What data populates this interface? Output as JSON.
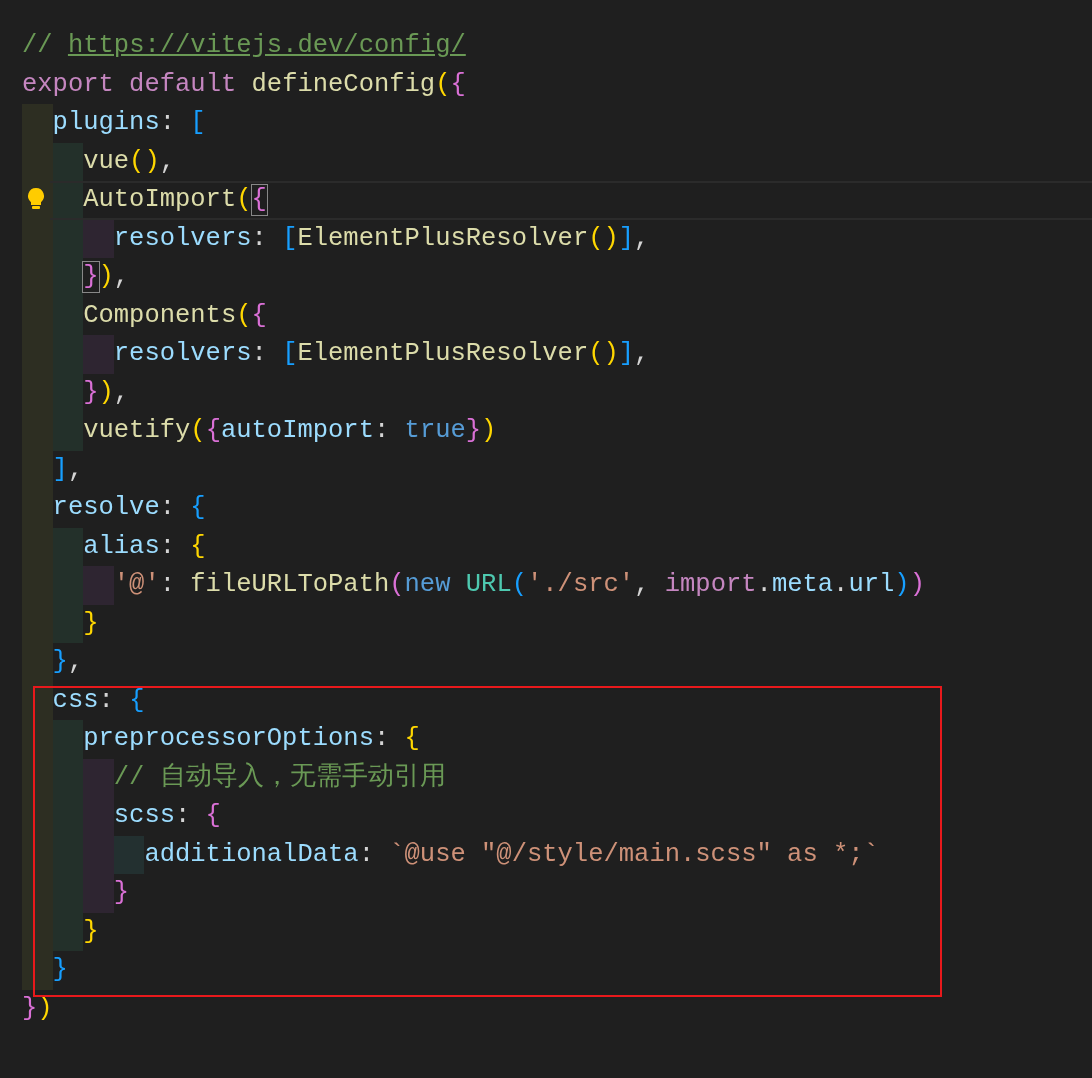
{
  "editor": {
    "lines": [
      {
        "current": false,
        "tokens": [
          {
            "kind": "comment",
            "text": "// "
          },
          {
            "kind": "link",
            "text": "https://vitejs.dev/config/"
          }
        ]
      },
      {
        "current": false,
        "tokens": [
          {
            "kind": "keyword",
            "text": "export default "
          },
          {
            "kind": "function",
            "text": "defineConfig"
          },
          {
            "kind": "b1",
            "text": "("
          },
          {
            "kind": "b2",
            "text": "{"
          }
        ]
      },
      {
        "current": false,
        "tokens": [
          {
            "kind": "property",
            "text": "  plugins"
          },
          {
            "kind": "punct",
            "text": ": "
          },
          {
            "kind": "b3",
            "text": "["
          }
        ]
      },
      {
        "current": false,
        "tokens": [
          {
            "kind": "function",
            "text": "    vue"
          },
          {
            "kind": "b1",
            "text": "()"
          },
          {
            "kind": "punct",
            "text": ","
          }
        ]
      },
      {
        "current": true,
        "lightbulb": true,
        "tokens": [
          {
            "kind": "function",
            "text": "    AutoImport"
          },
          {
            "kind": "b1",
            "text": "("
          },
          {
            "kind": "b2",
            "text": "{",
            "matched": true
          }
        ]
      },
      {
        "current": false,
        "tokens": [
          {
            "kind": "property",
            "text": "      resolvers"
          },
          {
            "kind": "punct",
            "text": ": "
          },
          {
            "kind": "b3",
            "text": "["
          },
          {
            "kind": "function",
            "text": "ElementPlusResolver"
          },
          {
            "kind": "b1",
            "text": "()"
          },
          {
            "kind": "b3",
            "text": "]"
          },
          {
            "kind": "punct",
            "text": ","
          }
        ]
      },
      {
        "current": false,
        "tokens": [
          {
            "kind": "b2",
            "text": "    }",
            "matched": true
          },
          {
            "kind": "b1",
            "text": ")"
          },
          {
            "kind": "punct",
            "text": ","
          }
        ]
      },
      {
        "current": false,
        "tokens": [
          {
            "kind": "function",
            "text": "    Components"
          },
          {
            "kind": "b1",
            "text": "("
          },
          {
            "kind": "b2",
            "text": "{"
          }
        ]
      },
      {
        "current": false,
        "tokens": [
          {
            "kind": "property",
            "text": "      resolvers"
          },
          {
            "kind": "punct",
            "text": ": "
          },
          {
            "kind": "b3",
            "text": "["
          },
          {
            "kind": "function",
            "text": "ElementPlusResolver"
          },
          {
            "kind": "b1",
            "text": "()"
          },
          {
            "kind": "b3",
            "text": "]"
          },
          {
            "kind": "punct",
            "text": ","
          }
        ]
      },
      {
        "current": false,
        "tokens": [
          {
            "kind": "b2",
            "text": "    }"
          },
          {
            "kind": "b1",
            "text": ")"
          },
          {
            "kind": "punct",
            "text": ","
          }
        ]
      },
      {
        "current": false,
        "tokens": [
          {
            "kind": "function",
            "text": "    vuetify"
          },
          {
            "kind": "b1",
            "text": "("
          },
          {
            "kind": "b2",
            "text": "{"
          },
          {
            "kind": "property",
            "text": "autoImport"
          },
          {
            "kind": "punct",
            "text": ": "
          },
          {
            "kind": "constant",
            "text": "true"
          },
          {
            "kind": "b2",
            "text": "}"
          },
          {
            "kind": "b1",
            "text": ")"
          }
        ]
      },
      {
        "current": false,
        "tokens": [
          {
            "kind": "b3",
            "text": "  ]"
          },
          {
            "kind": "punct",
            "text": ","
          }
        ]
      },
      {
        "current": false,
        "tokens": [
          {
            "kind": "property",
            "text": "  resolve"
          },
          {
            "kind": "punct",
            "text": ": "
          },
          {
            "kind": "b3",
            "text": "{"
          }
        ]
      },
      {
        "current": false,
        "tokens": [
          {
            "kind": "property",
            "text": "    alias"
          },
          {
            "kind": "punct",
            "text": ": "
          },
          {
            "kind": "b1",
            "text": "{"
          }
        ]
      },
      {
        "current": false,
        "tokens": [
          {
            "kind": "string",
            "text": "      '@'"
          },
          {
            "kind": "punct",
            "text": ": "
          },
          {
            "kind": "function",
            "text": "fileURLToPath"
          },
          {
            "kind": "b2",
            "text": "("
          },
          {
            "kind": "constant",
            "text": "new "
          },
          {
            "kind": "type",
            "text": "URL"
          },
          {
            "kind": "b3",
            "text": "("
          },
          {
            "kind": "string",
            "text": "'./src'"
          },
          {
            "kind": "punct",
            "text": ", "
          },
          {
            "kind": "keyword",
            "text": "import"
          },
          {
            "kind": "punct",
            "text": "."
          },
          {
            "kind": "property",
            "text": "meta"
          },
          {
            "kind": "punct",
            "text": "."
          },
          {
            "kind": "property",
            "text": "url"
          },
          {
            "kind": "b3",
            "text": ")"
          },
          {
            "kind": "b2",
            "text": ")"
          }
        ]
      },
      {
        "current": false,
        "tokens": [
          {
            "kind": "b1",
            "text": "    }"
          }
        ]
      },
      {
        "current": false,
        "tokens": [
          {
            "kind": "b3",
            "text": "  }"
          },
          {
            "kind": "punct",
            "text": ","
          }
        ]
      },
      {
        "current": false,
        "tokens": [
          {
            "kind": "property",
            "text": "  css"
          },
          {
            "kind": "punct",
            "text": ": "
          },
          {
            "kind": "b3",
            "text": "{"
          }
        ]
      },
      {
        "current": false,
        "tokens": [
          {
            "kind": "property",
            "text": "    preprocessorOptions"
          },
          {
            "kind": "punct",
            "text": ": "
          },
          {
            "kind": "b1",
            "text": "{"
          }
        ]
      },
      {
        "current": false,
        "tokens": [
          {
            "kind": "comment",
            "text": "      // 自动导入，无需手动引用"
          }
        ]
      },
      {
        "current": false,
        "tokens": [
          {
            "kind": "property",
            "text": "      scss"
          },
          {
            "kind": "punct",
            "text": ": "
          },
          {
            "kind": "b2",
            "text": "{"
          }
        ]
      },
      {
        "current": false,
        "tokens": [
          {
            "kind": "property",
            "text": "        additionalData"
          },
          {
            "kind": "punct",
            "text": ": "
          },
          {
            "kind": "string",
            "text": "`@use \"@/style/main.scss\" as *;`"
          }
        ]
      },
      {
        "current": false,
        "tokens": [
          {
            "kind": "b2",
            "text": "      }"
          }
        ]
      },
      {
        "current": false,
        "tokens": [
          {
            "kind": "b1",
            "text": "    }"
          }
        ]
      },
      {
        "current": false,
        "tokens": [
          {
            "kind": "b3",
            "text": "  }"
          }
        ]
      },
      {
        "current": false,
        "tokens": [
          {
            "kind": "b2",
            "text": "}"
          },
          {
            "kind": "b1",
            "text": ")"
          }
        ]
      }
    ]
  }
}
